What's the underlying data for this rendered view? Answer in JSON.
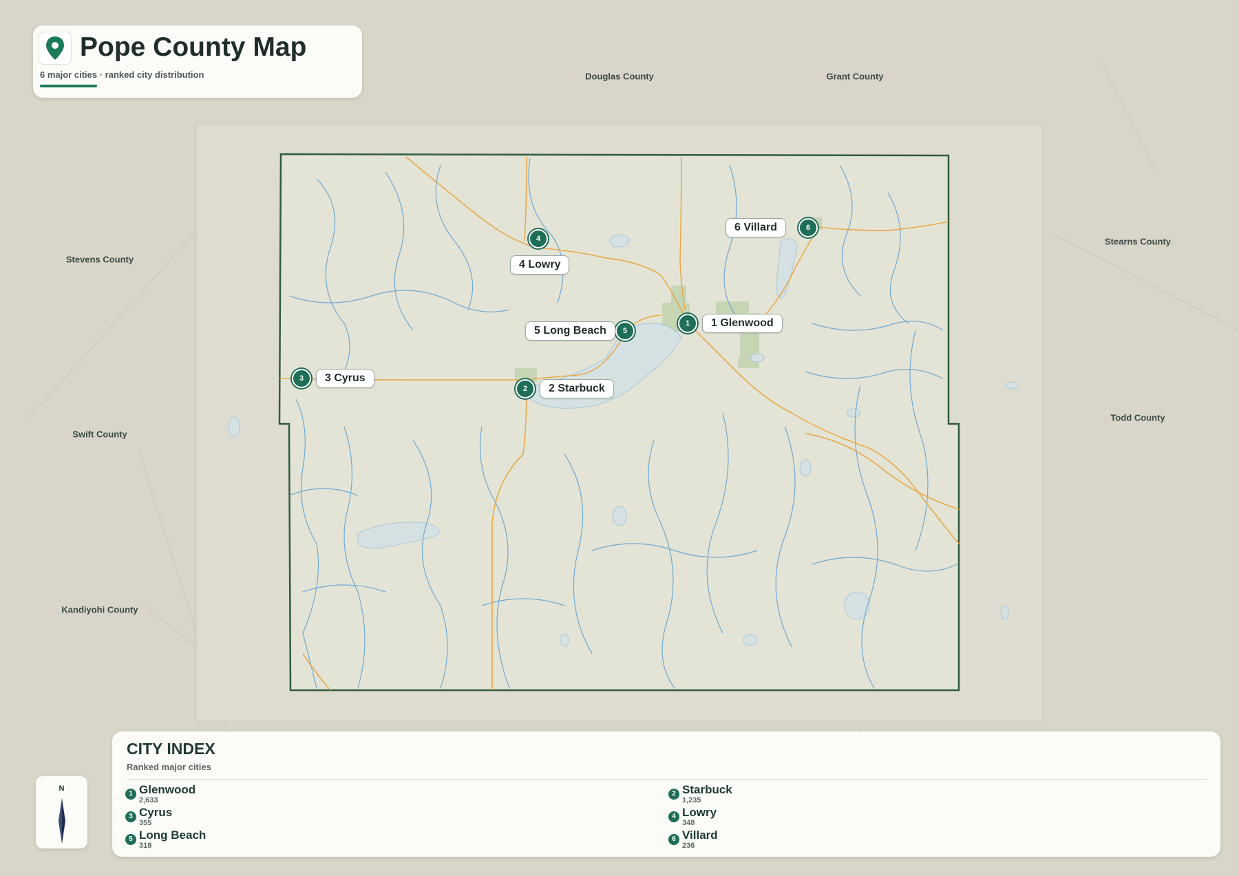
{
  "title": {
    "text": "Pope County Map",
    "subtitle": "6 major cities · ranked city distribution",
    "icon": "map-pin-icon"
  },
  "neighbors": [
    {
      "name": "Douglas County"
    },
    {
      "name": "Grant County"
    },
    {
      "name": "Stevens County"
    },
    {
      "name": "Stearns County"
    },
    {
      "name": "Swift County"
    },
    {
      "name": "Todd County"
    },
    {
      "name": "Kandiyohi County"
    }
  ],
  "cities": [
    {
      "rank": "1",
      "label": "1 Glenwood"
    },
    {
      "rank": "2",
      "label": "2 Starbuck"
    },
    {
      "rank": "3",
      "label": "3 Cyrus"
    },
    {
      "rank": "4",
      "label": "4 Lowry"
    },
    {
      "rank": "5",
      "label": "5 Long Beach"
    },
    {
      "rank": "6",
      "label": "6 Villard"
    }
  ],
  "compass": {
    "north": "N",
    "icon": "north-arrow-icon"
  },
  "index": {
    "title": "CITY INDEX",
    "subtitle": "Ranked major cities",
    "entries": [
      {
        "rank": "1",
        "name": "Glenwood",
        "population": "2,633"
      },
      {
        "rank": "2",
        "name": "Starbuck",
        "population": "1,235"
      },
      {
        "rank": "3",
        "name": "Cyrus",
        "population": "355"
      },
      {
        "rank": "4",
        "name": "Lowry",
        "population": "348"
      },
      {
        "rank": "5",
        "name": "Long Beach",
        "population": "318"
      },
      {
        "rank": "6",
        "name": "Villard",
        "population": "236"
      }
    ]
  },
  "colors": {
    "background": "#d9d5c9",
    "county_fill": "#e2e3d4",
    "boundary": "#2f5c3c",
    "water": "#4a92c9",
    "lake": "#d6e2e4",
    "road": "#e8a94a",
    "urban": "#b8cfa8",
    "marker": "#1f6e57"
  }
}
